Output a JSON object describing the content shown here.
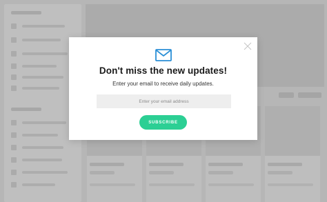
{
  "modal": {
    "icon": "envelope-icon",
    "title": "Don't miss the new updates!",
    "subtitle": "Enter your email to receive daily updates.",
    "email_placeholder": "Enter your email address",
    "email_value": "",
    "subscribe_label": "SUBSCRIBE",
    "close_icon": "close-icon"
  },
  "colors": {
    "accent": "#2ccf94",
    "icon": "#2a8fd6",
    "input_bg": "#eeeeee",
    "overlay": "#cfcfcf"
  }
}
